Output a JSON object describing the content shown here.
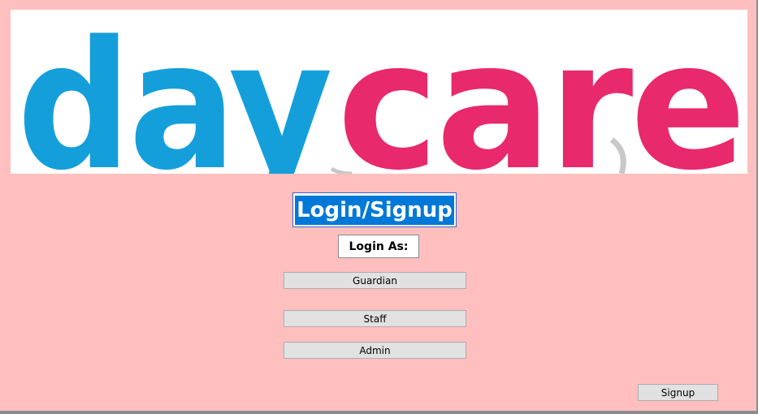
{
  "banner": {
    "logo_word_part1": "day",
    "logo_word_part2": "care",
    "colors": {
      "part1": "#149FDB",
      "part2": "#E8296B",
      "background": "#FFFFFF"
    }
  },
  "title": "Login/Signup",
  "login_as_label": "Login As:",
  "roles": {
    "guardian": "Guardian",
    "staff": "Staff",
    "admin": "Admin"
  },
  "signup_label": "Signup",
  "colors": {
    "window_background": "#FFBFBF",
    "selection_highlight": "#0078D7",
    "button_face": "#E1E1E1"
  }
}
